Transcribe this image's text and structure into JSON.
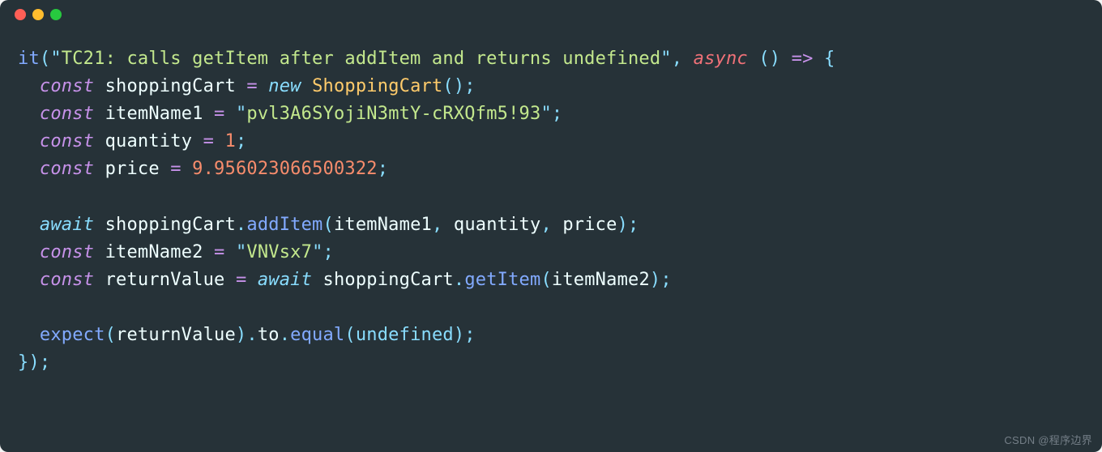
{
  "traffic_lights": [
    "red",
    "yellow",
    "green"
  ],
  "code": {
    "fn_it": "it",
    "test_title": "TC21: calls getItem after addItem and returns undefined",
    "kw_async": "async",
    "arrow": "=>",
    "kw_const": "const",
    "kw_new": "new",
    "kw_await": "await",
    "var_shoppingCart": "shoppingCart",
    "class_ShoppingCart": "ShoppingCart",
    "var_itemName1": "itemName1",
    "val_itemName1": "pvl3A6SYojiN3mtY-cRXQfm5!93",
    "var_quantity": "quantity",
    "val_quantity": "1",
    "var_price": "price",
    "val_price": "9.956023066500322",
    "method_addItem": "addItem",
    "var_itemName2": "itemName2",
    "val_itemName2": "VNVsx7",
    "var_returnValue": "returnValue",
    "method_getItem": "getItem",
    "fn_expect": "expect",
    "prop_to": "to",
    "method_equal": "equal",
    "val_undefined": "undefined"
  },
  "watermark": "CSDN @程序边界"
}
